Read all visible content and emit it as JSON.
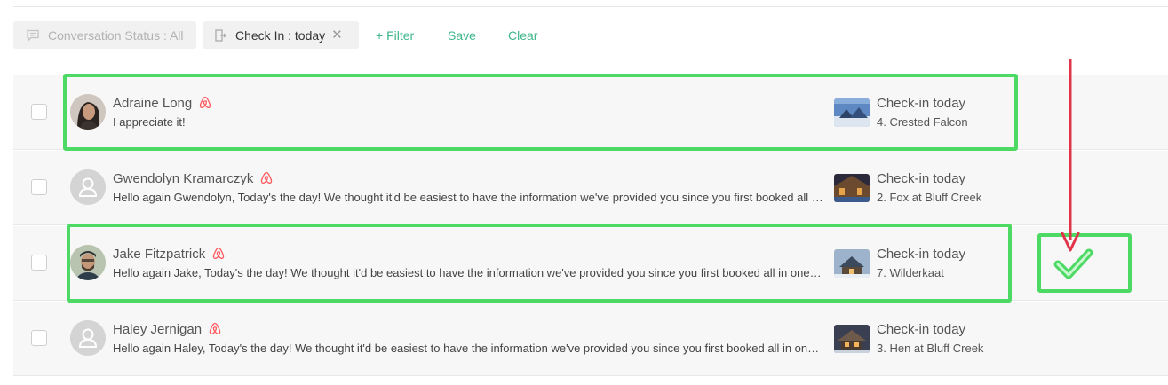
{
  "filters": {
    "status_chip": "Conversation Status : All",
    "checkin_chip": "Check In : today",
    "add_filter": "+ Filter",
    "save": "Save",
    "clear": "Clear"
  },
  "conversations": [
    {
      "name": "Adraine Long",
      "message": "I appreciate it!",
      "checkin": "Check-in today",
      "property": "4. Crested Falcon",
      "avatar": "photo"
    },
    {
      "name": "Gwendolyn Kramarczyk",
      "message": "Hello again Gwendolyn, Today's the day! We thought it'd be easiest to have the information we've provided you since you first booked all in one place.",
      "checkin": "Check-in today",
      "property": "2. Fox at Bluff Creek",
      "avatar": "placeholder"
    },
    {
      "name": "Jake Fitzpatrick",
      "message": "Hello again Jake, Today's the day! We thought it'd be easiest to have the information we've provided you since you first booked all in one place.",
      "checkin": "Check-in today",
      "property": "7. Wilderkaat",
      "avatar": "photo"
    },
    {
      "name": "Haley Jernigan",
      "message": "Hello again Haley, Today's the day! We thought it'd be easiest to have the information we've provided you since you first booked all in one place.",
      "checkin": "Check-in today",
      "property": "3. Hen at Bluff Creek",
      "avatar": "placeholder"
    }
  ],
  "colors": {
    "accent": "#3fb68b",
    "airbnb": "#ff5a5f",
    "highlight": "#4cd964",
    "arrow": "#e0344a"
  },
  "icons": {
    "status_chip": "chat-bubble-icon",
    "checkin_chip": "check-in-icon",
    "channel": "airbnb-icon",
    "annotation": "check-mark-icon"
  }
}
